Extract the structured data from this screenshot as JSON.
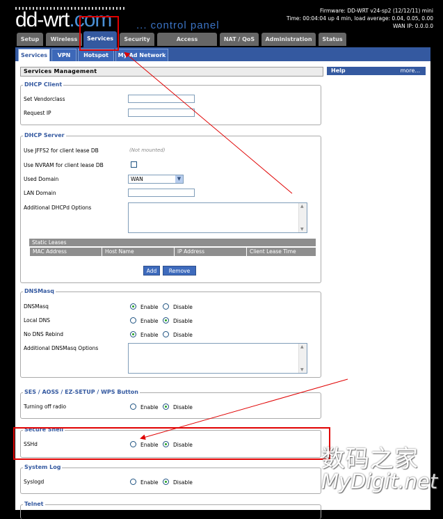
{
  "header": {
    "logo_text": "dd-wrt",
    "logo_dot": ".com",
    "tagline": "... control panel",
    "firmware": "Firmware: DD-WRT v24-sp2 (12/12/11) mini",
    "time": "Time: 00:04:04 up 4 min, load average: 0.04, 0.05, 0.00",
    "wan_ip": "WAN IP: 0.0.0.0"
  },
  "tabs": [
    "Setup",
    "Wireless",
    "Services",
    "Security",
    "Access Restrictions",
    "NAT / QoS",
    "Administration",
    "Status"
  ],
  "subtabs": [
    "Services",
    "VPN",
    "Hotspot",
    "My Ad Network"
  ],
  "panel_title": "Services Management",
  "help": {
    "title": "Help",
    "more": "more..."
  },
  "dhcp_client": {
    "legend": "DHCP Client",
    "vendorclass_label": "Set Vendorclass",
    "request_ip_label": "Request IP"
  },
  "dhcp_server": {
    "legend": "DHCP Server",
    "jffs2_label": "Use JFFS2 for client lease DB",
    "jffs2_hint": "(Not mounted)",
    "nvram_label": "Use NVRAM for client lease DB",
    "used_domain_label": "Used Domain",
    "used_domain_value": "WAN",
    "lan_domain_label": "LAN Domain",
    "additional_label": "Additional DHCPd Options",
    "static_leases_title": "Static Leases",
    "columns": [
      "MAC Address",
      "Host Name",
      "IP Address",
      "Client Lease Time"
    ],
    "add_label": "Add",
    "remove_label": "Remove"
  },
  "dnsmasq": {
    "legend": "DNSMasq",
    "dnsmasq_label": "DNSMasq",
    "local_dns_label": "Local DNS",
    "no_rebind_label": "No DNS Rebind",
    "additional_label": "Additional DNSMasq Options"
  },
  "ses": {
    "legend": "SES / AOSS / EZ-SETUP / WPS Button",
    "radio_off_label": "Turning off radio"
  },
  "ssh": {
    "legend": "Secure Shell",
    "sshd_label": "SSHd"
  },
  "syslog": {
    "legend": "System Log",
    "syslogd_label": "Syslogd"
  },
  "telnet": {
    "legend": "Telnet"
  },
  "radio": {
    "enable": "Enable",
    "disable": "Disable"
  },
  "watermark": {
    "line1": "数码之家",
    "line2": "MyDigit.net"
  },
  "colors": {
    "accent": "#3459a0",
    "annotation": "#e00000"
  }
}
